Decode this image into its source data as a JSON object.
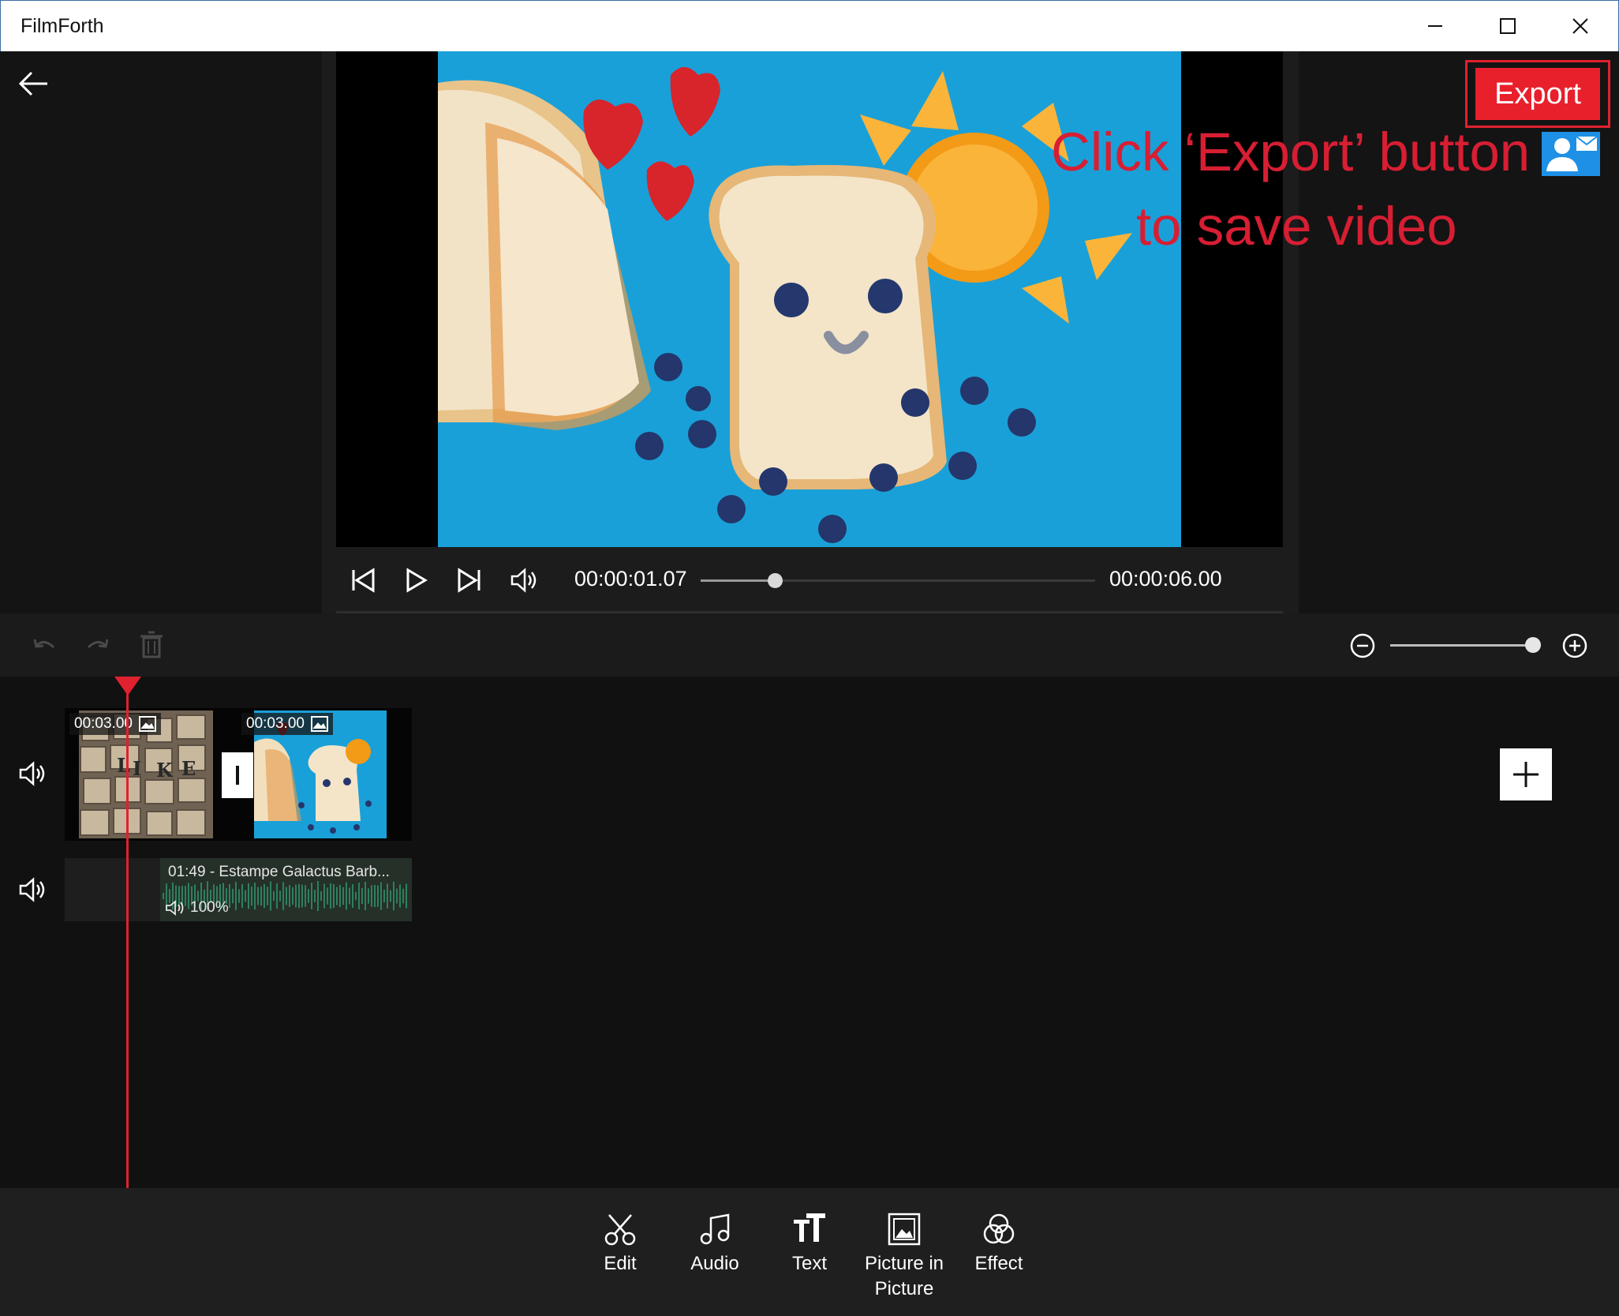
{
  "window": {
    "title": "FilmForth"
  },
  "header": {
    "export_label": "Export"
  },
  "annotation": {
    "line1": "Click ‘Export’ button",
    "line2": "to save video"
  },
  "player": {
    "current_time": "00:00:01.07",
    "total_time": "00:00:06.00",
    "progress": 0.19
  },
  "zoom": {
    "level": 0.95
  },
  "timeline": {
    "clips": [
      {
        "duration": "00:03.00",
        "letters": "L I K E"
      },
      {
        "duration": "00:03.00"
      }
    ],
    "audio": {
      "title": "01:49 - Estampe Galactus Barb...",
      "volume": "100%"
    }
  },
  "toolbar": {
    "items": [
      {
        "label": "Edit",
        "icon": "scissors-icon"
      },
      {
        "label": "Audio",
        "icon": "music-note-icon"
      },
      {
        "label": "Text",
        "icon": "text-icon"
      },
      {
        "label": "Picture in Picture",
        "icon": "image-icon"
      },
      {
        "label": "Effect",
        "icon": "effect-icon"
      }
    ]
  },
  "colors": {
    "accent": "#e8202c",
    "annotation": "#d71e33",
    "playhead": "#e0212f",
    "preview_bg": "#1aa0d8"
  }
}
